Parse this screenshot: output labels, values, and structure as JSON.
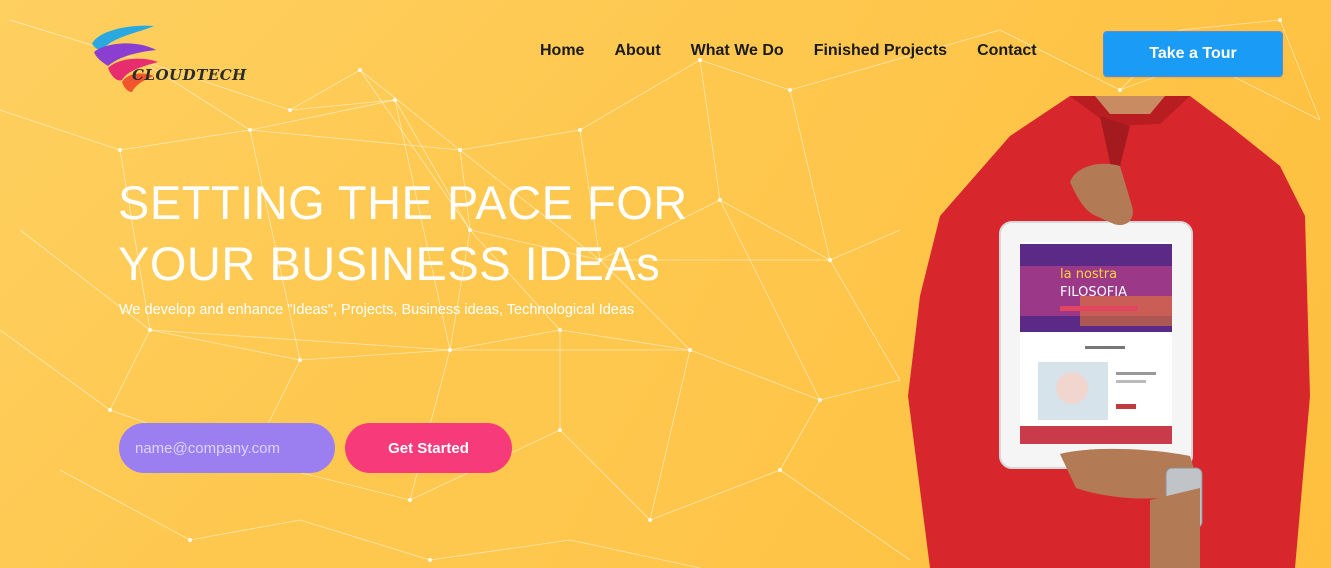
{
  "brand": {
    "logo_text": "CLOUDTECH"
  },
  "nav": {
    "items": [
      {
        "label": "Home"
      },
      {
        "label": "About"
      },
      {
        "label": "What We Do"
      },
      {
        "label": "Finished Projects"
      },
      {
        "label": "Contact"
      }
    ],
    "cta_label": "Take a Tour"
  },
  "hero": {
    "title_line1": "SETTING THE PACE FOR",
    "title_line2": "YOUR BUSINESS IDEAs",
    "subtitle": "We develop and enhance \"Ideas\", Projects, Business ideas, Technological Ideas",
    "email_placeholder": "name@company.com",
    "submit_label": "Get Started"
  },
  "tablet_screen": {
    "headline_1": "la nostra",
    "headline_2": "FILOSOFIA"
  },
  "colors": {
    "background": "#fec84f",
    "accent_blue": "#1a9bf5",
    "input_purple": "#9b7ff0",
    "button_pink": "#f73b7a",
    "shirt_red": "#d7262c"
  },
  "icons": [
    "cloudtech-logo",
    "person-holding-tablet-image"
  ]
}
